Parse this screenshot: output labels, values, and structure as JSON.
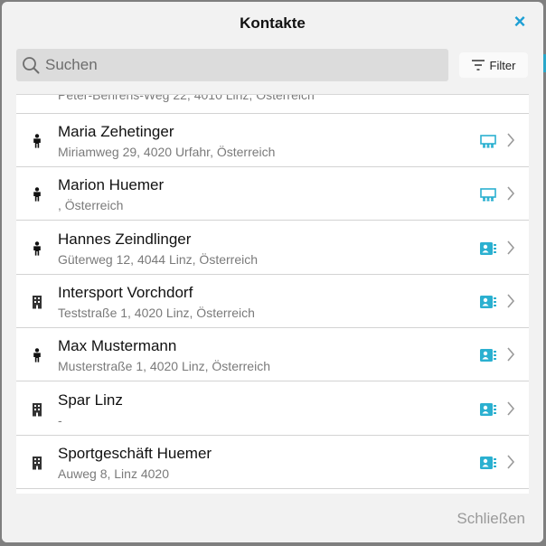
{
  "dialog": {
    "title": "Kontakte",
    "close_icon": "×",
    "search_placeholder": "Suchen",
    "filter_label": "Filter",
    "footer_close_label": "Schließen"
  },
  "partial_row": {
    "address": "Peter-Behrens-Weg 22, 4010 Linz, Österreich"
  },
  "contacts": [
    {
      "name": "Maria Zehetinger",
      "address": "Miriamweg 29, 4020 Urfahr, Österreich",
      "type": "person-icon",
      "status": "group-icon"
    },
    {
      "name": "Marion Huemer",
      "address": ", Österreich",
      "type": "person-icon",
      "status": "group-icon"
    },
    {
      "name": "Hannes Zeindlinger",
      "address": "Güterweg 12, 4044 Linz, Österreich",
      "type": "person-icon",
      "status": "contact-card-icon"
    },
    {
      "name": "Intersport Vorchdorf",
      "address": "Teststraße 1, 4020 Linz, Österreich",
      "type": "building-icon",
      "status": "contact-card-icon"
    },
    {
      "name": "Max Mustermann",
      "address": "Musterstraße 1, 4020 Linz, Österreich",
      "type": "person-icon",
      "status": "contact-card-icon"
    },
    {
      "name": "Spar Linz",
      "address": "-",
      "type": "building-icon",
      "status": "contact-card-icon"
    },
    {
      "name": "Sportgeschäft Huemer",
      "address": "Auweg 8, Linz 4020",
      "type": "building-icon",
      "status": "contact-card-icon"
    }
  ],
  "colors": {
    "accent": "#1d9fd4",
    "icon_teal": "#2bb0d0"
  }
}
